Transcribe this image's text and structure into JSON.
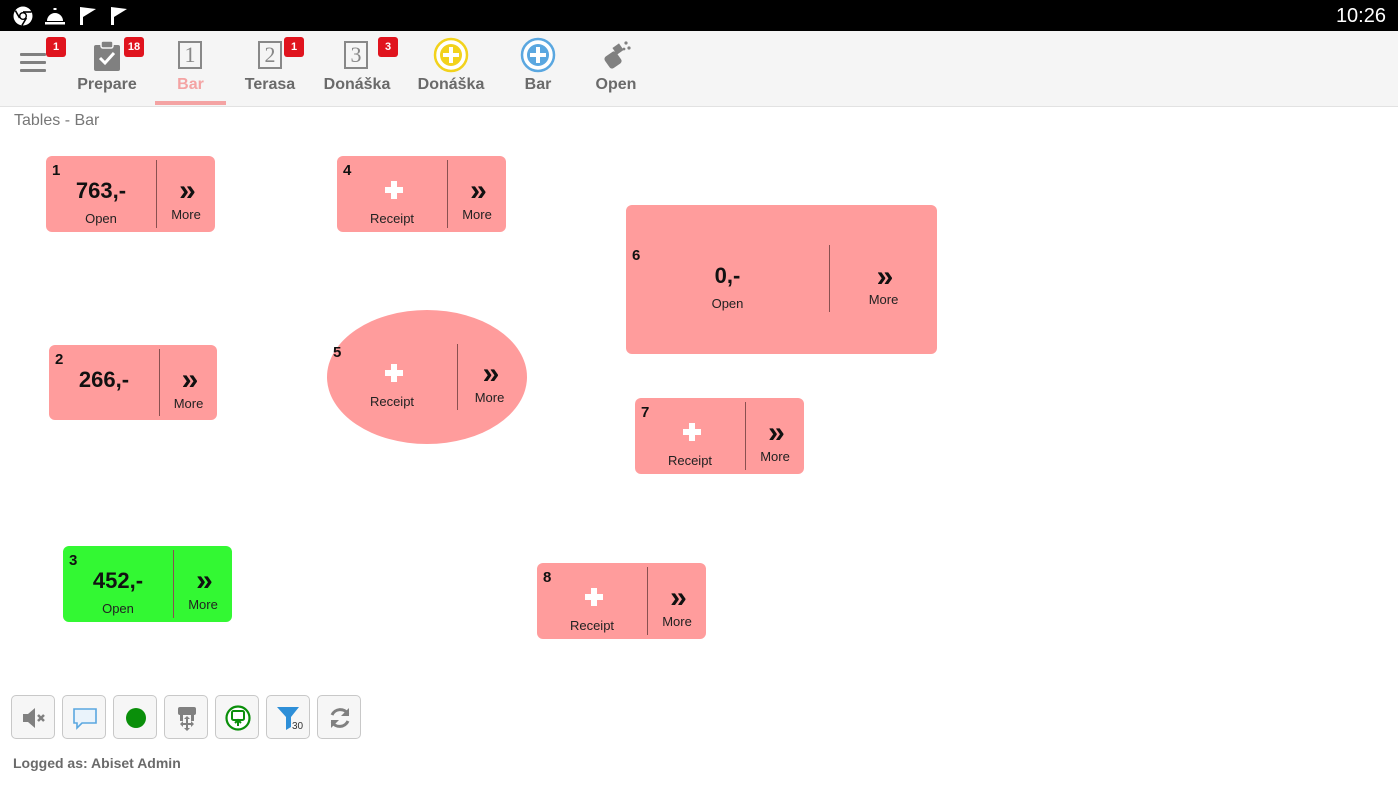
{
  "status_bar": {
    "time": "10:26",
    "icons": [
      "chrome-icon",
      "service-bell-icon",
      "checkmark-flag-icon",
      "checkmark-flag-icon"
    ]
  },
  "toolbar": {
    "menu": {
      "icon": "hamburger-menu-icon",
      "badge": "1"
    },
    "items": [
      {
        "label": "Prepare",
        "icon": "clipboard-check-icon",
        "badge": "18",
        "active": false
      },
      {
        "label": "Bar",
        "icon": "number-1-icon",
        "icon_text": "1",
        "badge": "",
        "active": true
      },
      {
        "label": "Terasa",
        "icon": "number-2-icon",
        "icon_text": "2",
        "badge": "1",
        "active": false
      },
      {
        "label": "Donáška",
        "icon": "number-3-icon",
        "icon_text": "3",
        "badge": "3",
        "active": false
      },
      {
        "label": "Donáška",
        "icon": "add-circle-yellow-icon",
        "badge": "",
        "active": false
      },
      {
        "label": "Bar",
        "icon": "add-circle-blue-icon",
        "badge": "",
        "active": false
      },
      {
        "label": "Open",
        "icon": "spray-cleaning-icon",
        "badge": "",
        "active": false
      }
    ]
  },
  "section_title": "Tables - Bar",
  "tables": [
    {
      "number": "1",
      "amount": "763,-",
      "status": "Open",
      "more": "More",
      "color": "#ff9c9c"
    },
    {
      "number": "2",
      "amount": "266,-",
      "status": "",
      "more": "More",
      "color": "#ff9c9c"
    },
    {
      "number": "3",
      "amount": "452,-",
      "status": "Open",
      "more": "More",
      "color": "#33f833"
    },
    {
      "number": "4",
      "action": "Receipt",
      "more": "More",
      "color": "#ff9c9c"
    },
    {
      "number": "5",
      "action": "Receipt",
      "more": "More",
      "color": "#ff9c9c",
      "shape": "oval"
    },
    {
      "number": "6",
      "amount": "0,-",
      "status": "Open",
      "more": "More",
      "color": "#ff9c9c"
    },
    {
      "number": "7",
      "action": "Receipt",
      "more": "More",
      "color": "#ff9c9c"
    },
    {
      "number": "8",
      "action": "Receipt",
      "more": "More",
      "color": "#ff9c9c"
    }
  ],
  "bottom_buttons": [
    {
      "icon": "speaker-mute-icon"
    },
    {
      "icon": "chat-bubble-icon"
    },
    {
      "icon": "green-dot-icon"
    },
    {
      "icon": "move-tables-icon"
    },
    {
      "icon": "pos-terminal-icon"
    },
    {
      "icon": "filter-icon",
      "badge": "30"
    },
    {
      "icon": "refresh-icon"
    }
  ],
  "logged_as": "Logged as: Abiset Admin",
  "colors": {
    "table_default": "#ff9c9c",
    "table_occupied": "#33f833",
    "active_tab": "#f4a3a3",
    "badge": "#e0141e"
  }
}
